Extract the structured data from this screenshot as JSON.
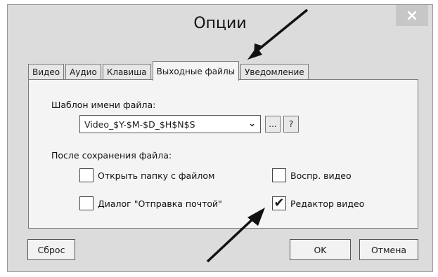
{
  "window": {
    "title": "Опции",
    "close_label": "×"
  },
  "tabs": [
    {
      "label": "Видео",
      "active": false
    },
    {
      "label": "Аудио",
      "active": false
    },
    {
      "label": "Клавиша",
      "active": false
    },
    {
      "label": "Выходные файлы",
      "active": true
    },
    {
      "label": "Уведомление",
      "active": false
    }
  ],
  "filename_template": {
    "label": "Шаблон имени файла:",
    "value": "Video_$Y-$M-$D_$H$N$S",
    "browse_label": "...",
    "help_label": "?"
  },
  "after_save": {
    "label": "После сохранения файла:",
    "options": [
      {
        "label": "Открыть папку с файлом",
        "checked": false
      },
      {
        "label": "Воспр. видео",
        "checked": false
      },
      {
        "label": "Диалог \"Отправка почтой\"",
        "checked": false
      },
      {
        "label": "Редактор видео",
        "checked": true
      }
    ]
  },
  "buttons": {
    "reset": "Сброс",
    "ok": "OK",
    "cancel": "Отмена"
  },
  "icons": {
    "close": "close-icon",
    "dropdown": "chevron-down-icon",
    "checkmark": "checkmark-icon",
    "annotation": "arrow-icon"
  }
}
